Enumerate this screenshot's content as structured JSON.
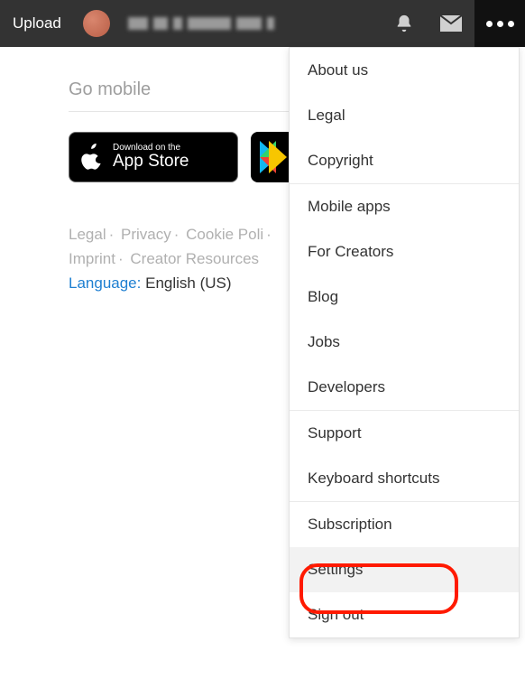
{
  "header": {
    "upload_label": "Upload"
  },
  "mobile": {
    "title": "Go mobile",
    "apple_small": "Download on the",
    "apple_big": "App Store"
  },
  "footer": {
    "links": [
      "Legal",
      "Privacy",
      "Cookie Poli",
      "Imprint",
      "Creator Resources"
    ],
    "language_label": "Language:",
    "language_value": "English (US)"
  },
  "menu": {
    "items": [
      "About us",
      "Legal",
      "Copyright",
      "Mobile apps",
      "For Creators",
      "Blog",
      "Jobs",
      "Developers",
      "Support",
      "Keyboard shortcuts",
      "Subscription",
      "Settings",
      "Sign out"
    ]
  }
}
